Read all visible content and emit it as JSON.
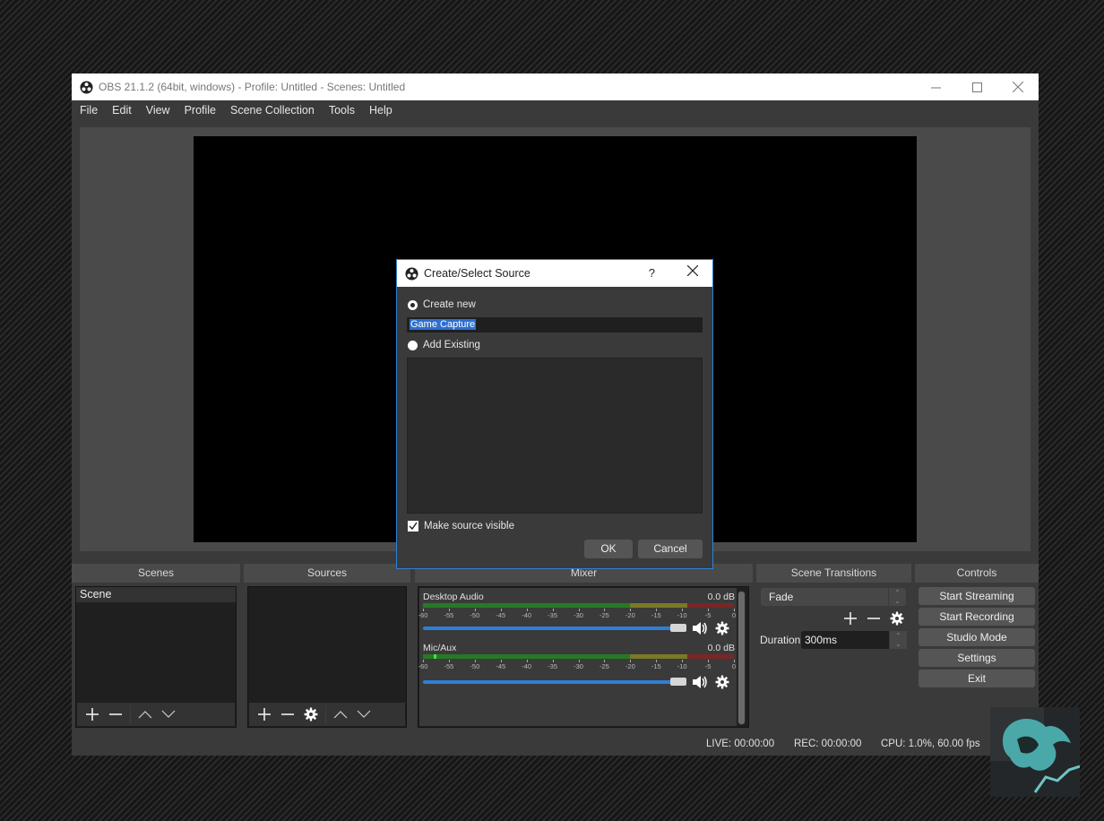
{
  "window": {
    "title": "OBS 21.1.2 (64bit, windows) - Profile: Untitled - Scenes: Untitled",
    "controls": {
      "minimize": "—",
      "maximize": "☐",
      "close": "✕"
    }
  },
  "menu": [
    "File",
    "Edit",
    "View",
    "Profile",
    "Scene Collection",
    "Tools",
    "Help"
  ],
  "docks": {
    "scenes": {
      "header": "Scenes",
      "items": [
        "Scene"
      ],
      "toolbar": [
        "add-icon",
        "remove-icon",
        "move-up-icon",
        "move-down-icon"
      ]
    },
    "sources": {
      "header": "Sources",
      "items": [],
      "toolbar": [
        "add-icon",
        "remove-icon",
        "properties-gear-icon",
        "move-up-icon",
        "move-down-icon"
      ]
    },
    "mixer": {
      "header": "Mixer",
      "tick_labels": [
        "-60",
        "-55",
        "-50",
        "-45",
        "-40",
        "-35",
        "-30",
        "-25",
        "-20",
        "-15",
        "-10",
        "-5",
        "0"
      ],
      "channels": [
        {
          "name": "Desktop Audio",
          "db": "0.0 dB",
          "volume_percent": 100,
          "meter_level_db": -60
        },
        {
          "name": "Mic/Aux",
          "db": "0.0 dB",
          "volume_percent": 100,
          "meter_level_db": -58
        }
      ],
      "colors": {
        "green": "#267a26",
        "yellow": "#7a7a26",
        "red": "#7a2626",
        "slider": "#2f7fd6",
        "peak": "#3ee43e"
      }
    },
    "transitions": {
      "header": "Scene Transitions",
      "selected": "Fade",
      "duration_label": "Duration",
      "duration_value": "300ms"
    },
    "controls": {
      "header": "Controls",
      "buttons": [
        "Start Streaming",
        "Start Recording",
        "Studio Mode",
        "Settings",
        "Exit"
      ]
    }
  },
  "status": {
    "live": "LIVE: 00:00:00",
    "rec": "REC: 00:00:00",
    "cpu": "CPU: 1.0%, 60.00 fps"
  },
  "dialog": {
    "title": "Create/Select Source",
    "help": "?",
    "close": "✕",
    "create_new_label": "Create new",
    "create_new_selected": true,
    "name_value": "Game Capture",
    "add_existing_label": "Add Existing",
    "add_existing_selected": false,
    "existing_items": [],
    "make_visible_label": "Make source visible",
    "make_visible_checked": true,
    "ok_label": "OK",
    "cancel_label": "Cancel",
    "accent": "#2d82d6"
  }
}
